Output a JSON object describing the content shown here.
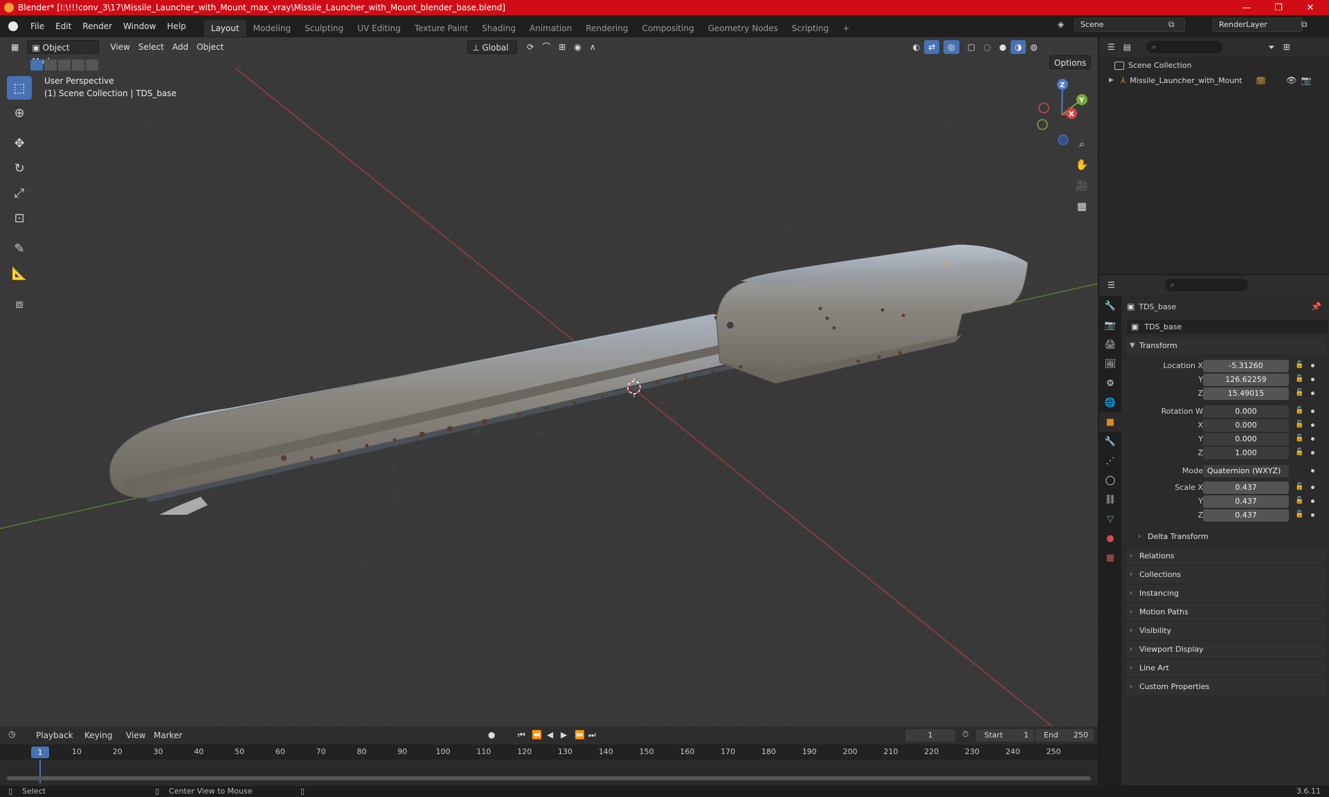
{
  "window": {
    "title": "Blender* [I:\\!!!conv_3\\17\\Missile_Launcher_with_Mount_max_vray\\Missile_Launcher_with_Mount_blender_base.blend]",
    "minimize": "—",
    "maximize": "❐",
    "close": "✕"
  },
  "menu": {
    "items": [
      "File",
      "Edit",
      "Render",
      "Window",
      "Help"
    ],
    "workspaces": [
      "Layout",
      "Modeling",
      "Sculpting",
      "UV Editing",
      "Texture Paint",
      "Shading",
      "Animation",
      "Rendering",
      "Compositing",
      "Geometry Nodes",
      "Scripting"
    ],
    "add_tab": "+",
    "scene": "Scene",
    "view_layer": "RenderLayer"
  },
  "viewport": {
    "mode": "Object Mode",
    "menus": [
      "View",
      "Select",
      "Add",
      "Object"
    ],
    "orientation": "Global",
    "options": "Options",
    "perspective": "User Perspective",
    "collection_info": "(1) Scene Collection | TDS_base",
    "gizmo": {
      "x": "X",
      "y": "Y",
      "z": "Z"
    }
  },
  "outliner": {
    "root": "Scene Collection",
    "items": [
      {
        "name": "Missile_Launcher_with_Mount"
      }
    ]
  },
  "properties": {
    "object_name": "TDS_base",
    "data_name": "TDS_base",
    "transform_title": "Transform",
    "location": {
      "label": "Location X",
      "x": "-5.31260",
      "y": "126.62259",
      "z": "15.49015"
    },
    "rotation": {
      "label": "Rotation W",
      "w": "0.000",
      "x": "0.000",
      "y": "0.000",
      "z": "1.000"
    },
    "mode_label": "Mode",
    "mode_value": "Quaternion (WXYZ)",
    "scale": {
      "label": "Scale X",
      "x": "0.437",
      "y": "0.437",
      "z": "0.437"
    },
    "axis": {
      "y": "Y",
      "z": "Z",
      "x": "X"
    },
    "delta": "Delta Transform",
    "panels": [
      "Relations",
      "Collections",
      "Instancing",
      "Motion Paths",
      "Visibility",
      "Viewport Display",
      "Line Art",
      "Custom Properties"
    ]
  },
  "timeline": {
    "menus": [
      "Playback",
      "Keying",
      "View",
      "Marker"
    ],
    "current_frame": "1",
    "start_label": "Start",
    "start": "1",
    "end_label": "End",
    "end": "250",
    "ticks": [
      "1",
      "10",
      "20",
      "30",
      "40",
      "50",
      "60",
      "70",
      "80",
      "90",
      "100",
      "110",
      "120",
      "130",
      "140",
      "150",
      "160",
      "170",
      "180",
      "190",
      "200",
      "210",
      "220",
      "230",
      "240",
      "250"
    ]
  },
  "status": {
    "left": "Select",
    "middle": "Center View to Mouse",
    "version": "3.6.11"
  },
  "colors": {
    "titlebar": "#d00d17",
    "accent": "#4772b3",
    "x_axis": "#c03a3a",
    "y_axis": "#6a9a2a",
    "object_orange": "#e08a1e"
  }
}
